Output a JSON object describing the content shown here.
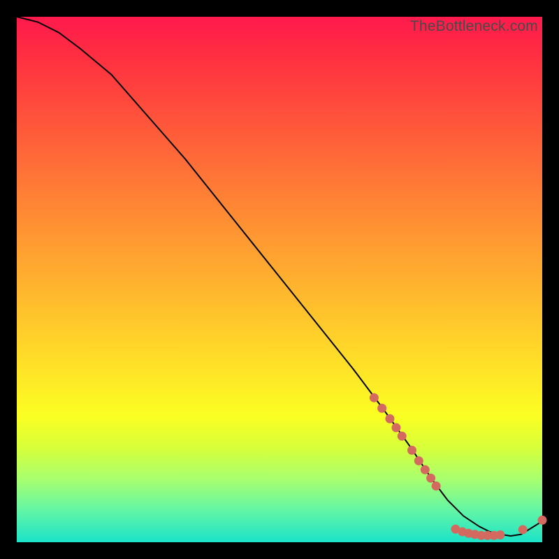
{
  "watermark": "TheBottleneck.com",
  "chart_data": {
    "type": "line",
    "title": "",
    "xlabel": "",
    "ylabel": "",
    "xlim": [
      0,
      100
    ],
    "ylim": [
      0,
      100
    ],
    "curve": {
      "x": [
        0,
        4,
        8,
        12,
        18,
        25,
        32,
        40,
        48,
        56,
        64,
        70,
        75,
        79,
        82,
        85,
        88,
        90,
        92,
        94,
        96,
        100
      ],
      "y": [
        100,
        99,
        97,
        94,
        89,
        81,
        73,
        63,
        53,
        43,
        33,
        25,
        18,
        12,
        8,
        5,
        3,
        2,
        1.5,
        1.2,
        1.5,
        4
      ]
    },
    "markers": [
      {
        "x": 68,
        "y": 27.5
      },
      {
        "x": 69.5,
        "y": 25.5
      },
      {
        "x": 71,
        "y": 23.5
      },
      {
        "x": 72.2,
        "y": 21.8
      },
      {
        "x": 73.3,
        "y": 20.2
      },
      {
        "x": 75.2,
        "y": 17.5
      },
      {
        "x": 76.5,
        "y": 15.5
      },
      {
        "x": 77.7,
        "y": 13.8
      },
      {
        "x": 78.8,
        "y": 12.2
      },
      {
        "x": 79.8,
        "y": 10.7
      },
      {
        "x": 83.5,
        "y": 2.5
      },
      {
        "x": 84.8,
        "y": 2.0
      },
      {
        "x": 86.0,
        "y": 1.7
      },
      {
        "x": 87.2,
        "y": 1.5
      },
      {
        "x": 88.4,
        "y": 1.3
      },
      {
        "x": 89.6,
        "y": 1.3
      },
      {
        "x": 90.8,
        "y": 1.3
      },
      {
        "x": 92.0,
        "y": 1.4
      },
      {
        "x": 96.3,
        "y": 2.4
      },
      {
        "x": 100,
        "y": 4.2
      }
    ],
    "marker_color": "#d46a5f",
    "curve_color": "#000000"
  }
}
